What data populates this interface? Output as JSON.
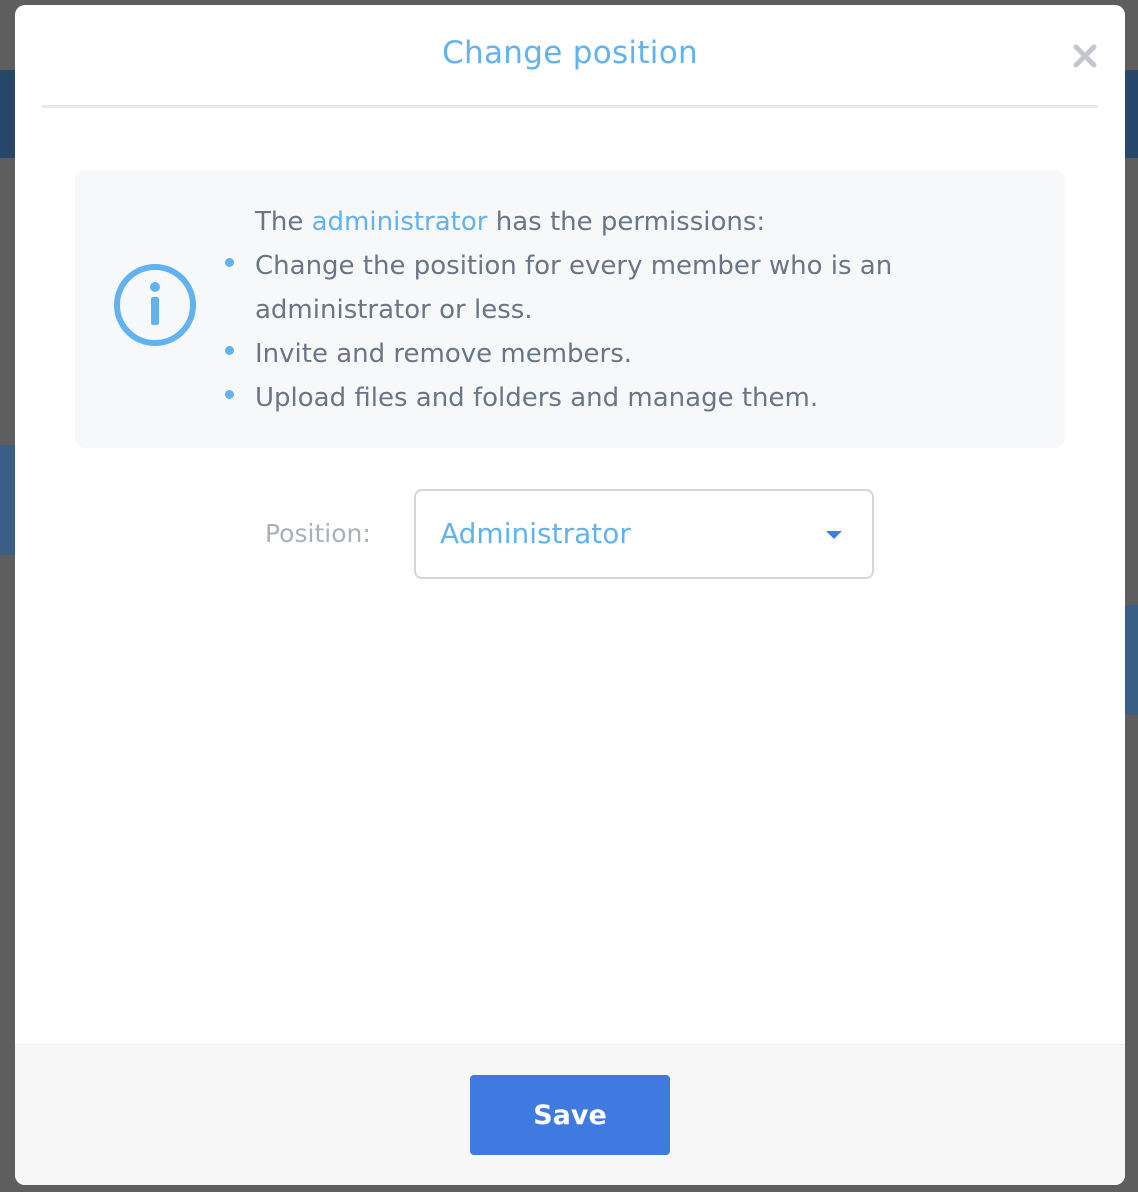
{
  "modal": {
    "title": "Change position",
    "close_icon": "close-icon"
  },
  "info": {
    "icon": "info-icon",
    "intro_prefix": "The ",
    "intro_role": "administrator",
    "intro_suffix": " has the permissions:",
    "permissions": [
      "Change the position for every member who is an administrator or less.",
      "Invite and remove members.",
      "Upload files and folders and manage them."
    ]
  },
  "position": {
    "label": "Position:",
    "selected": "Administrator"
  },
  "footer": {
    "save_label": "Save"
  },
  "colors": {
    "accent": "#62b2f0",
    "primary_button": "#3f7ae0",
    "text": "#6a7585"
  }
}
